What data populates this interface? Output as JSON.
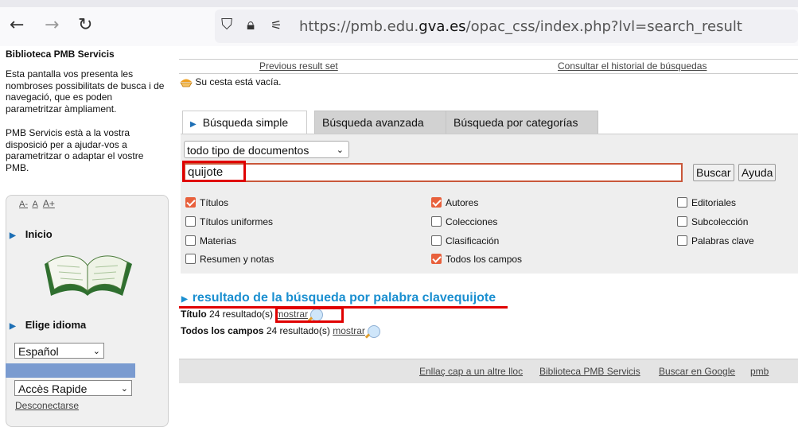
{
  "browser": {
    "url_prefix": "https://pmb.edu.",
    "url_domain": "gva.es",
    "url_suffix": "/opac_css/index.php?lvl=search_result"
  },
  "sidebar": {
    "title": "Biblioteca PMB Servicis",
    "intro_1": "Esta pantalla vos presenta les nombroses possibilitats de busca i de navegació, que es poden parametritzar àmpliament.",
    "intro_2": "PMB Servicis està a la vostra disposició per a ajudar-vos a parametritzar o adaptar el vostre PMB.",
    "font_small": "A-",
    "font_normal": "A",
    "font_large": "A+",
    "home_label": "Inicio",
    "language_heading": "Elige idioma",
    "language_value": "Español",
    "quick_access_value": "Accès Rapide",
    "logout_label": "Desconectarse"
  },
  "main": {
    "previous_results": "Previous result set",
    "search_history": "Consultar el historial de búsquedas",
    "basket_text": "Su cesta está vacía.",
    "tabs": [
      {
        "label": "Búsqueda simple"
      },
      {
        "label": "Búsqueda avanzada"
      },
      {
        "label": "Búsqueda por categorías"
      }
    ],
    "doc_type": "todo tipo de documentos",
    "search_value": "quijote",
    "search_button": "Buscar",
    "help_button": "Ayuda",
    "checkboxes": [
      {
        "label": "Títulos",
        "checked": true
      },
      {
        "label": "Títulos uniformes",
        "checked": false
      },
      {
        "label": "Materias",
        "checked": false
      },
      {
        "label": "Resumen y notas",
        "checked": false
      },
      {
        "label": "Autores",
        "checked": true
      },
      {
        "label": "Colecciones",
        "checked": false
      },
      {
        "label": "Clasificación",
        "checked": false
      },
      {
        "label": "Todos los campos",
        "checked": true
      },
      {
        "label": "Editoriales",
        "checked": false
      },
      {
        "label": "Subcolección",
        "checked": false
      },
      {
        "label": "Palabras clave",
        "checked": false
      }
    ],
    "result_heading": "resultado de la búsqueda por palabra clavequijote",
    "results": [
      {
        "field": "Título",
        "count": "24 resultado(s)",
        "action": "mostrar"
      },
      {
        "field": "Todos los campos",
        "count": "24 resultado(s)",
        "action": "mostrar"
      }
    ]
  },
  "footer": {
    "link_1": "Enllaç cap a un altre lloc",
    "link_2": "Biblioteca PMB Servicis",
    "link_3": "Buscar en Google",
    "link_4": "pmb"
  }
}
